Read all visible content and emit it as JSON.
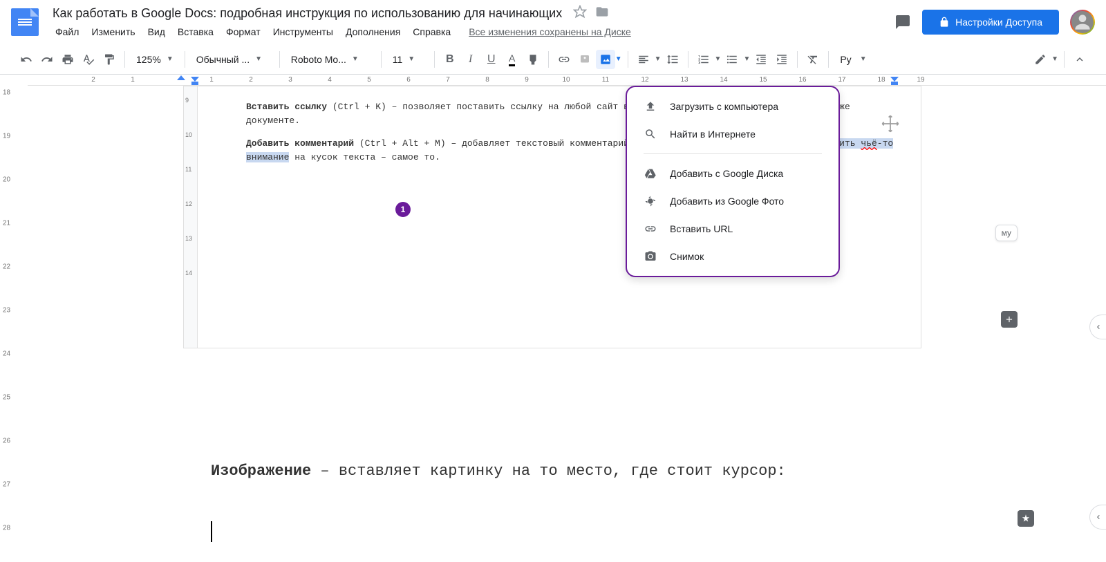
{
  "header": {
    "title": "Как работать в Google Docs: подробная инструкция по использованию для начинающих",
    "save_status": "Все изменения сохранены на Диске",
    "share_label": "Настройки Доступа"
  },
  "menu": {
    "file": "Файл",
    "edit": "Изменить",
    "view": "Вид",
    "insert": "Вставка",
    "format": "Формат",
    "tools": "Инструменты",
    "addons": "Дополнения",
    "help": "Справка"
  },
  "toolbar": {
    "zoom": "125%",
    "style": "Обычный ...",
    "font": "Roboto Mo...",
    "size": "11",
    "lang": "Ру"
  },
  "ruler_h": [
    "2",
    "1",
    "",
    "1",
    "2",
    "3",
    "4",
    "5",
    "6",
    "7",
    "8",
    "9",
    "10",
    "11",
    "12",
    "13",
    "14",
    "15",
    "16",
    "17",
    "18",
    "19"
  ],
  "ruler_v": [
    "18",
    "19",
    "20",
    "21",
    "22",
    "23",
    "24",
    "25",
    "26",
    "27",
    "28"
  ],
  "embed": {
    "ruler_v": [
      "9",
      "10",
      "11",
      "12",
      "13",
      "14"
    ],
    "p1_bold": "Вставить ссылку",
    "p1_shortcut": "(Ctrl + K)",
    "p1_rest": " – позволяет поставить ссылку на любой сайт в интернете или на другой раздел в этом же документе.",
    "p2_bold": "Добавить комментарий",
    "p2_shortcut": "(Ctrl + Alt + M)",
    "p2_a": " – добавляет текстовый комментарий к выделенному тексту. Если нужно ",
    "p2_hl1": "обратить ",
    "p2_err": "чьё",
    "p2_hl2": "-то внимание",
    "p2_b": " на кусок текста – самое то.",
    "tooltip": "му",
    "badge": "1"
  },
  "img_menu": {
    "upload": "Загрузить с компьютера",
    "search": "Найти в Интернете",
    "drive": "Добавить с Google Диска",
    "photos": "Добавить из Google Фото",
    "url": "Вставить URL",
    "camera": "Снимок"
  },
  "article": {
    "bold": "Изображение",
    "rest": " – вставляет картинку на то место, где стоит курсор:"
  }
}
